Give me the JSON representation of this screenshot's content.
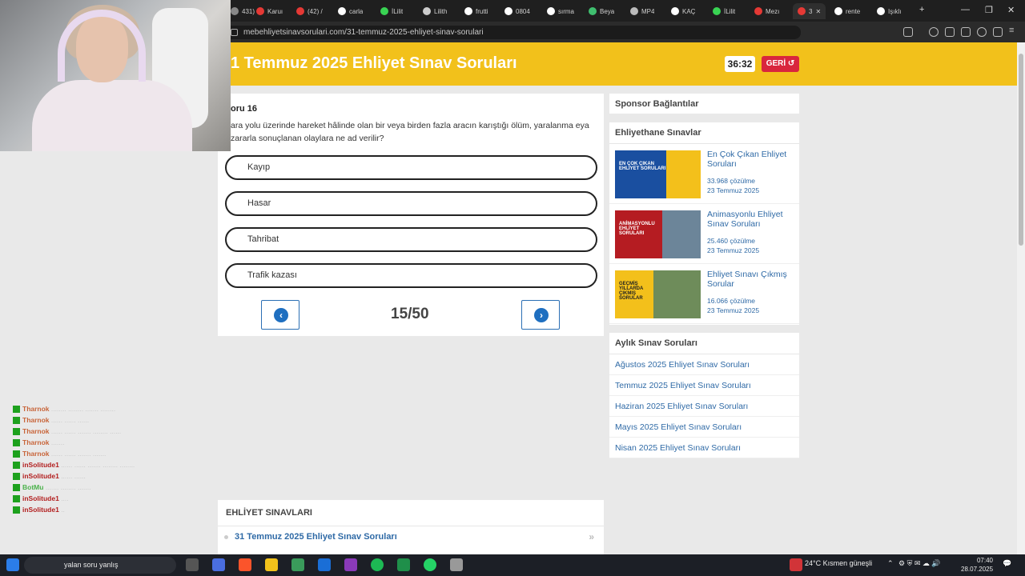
{
  "browser": {
    "tabs": [
      {
        "label": "431)",
        "color": "#888888"
      },
      {
        "label": "Karuı",
        "color": "#e53935"
      },
      {
        "label": "(42) /",
        "color": "#e53935"
      },
      {
        "label": "carla",
        "color": "#ffffff"
      },
      {
        "label": "İLilit",
        "color": "#39d353"
      },
      {
        "label": "Lilith",
        "color": "#cccccc"
      },
      {
        "label": "frutti",
        "color": "#ffffff"
      },
      {
        "label": "0804",
        "color": "#ffffff"
      },
      {
        "label": "sırma",
        "color": "#ffffff"
      },
      {
        "label": "Beya",
        "color": "#3fbf6f"
      },
      {
        "label": "MP4",
        "color": "#bbbbbb"
      },
      {
        "label": "KAÇ",
        "color": "#ffffff"
      },
      {
        "label": "İLilit",
        "color": "#39d353"
      },
      {
        "label": "Mezı",
        "color": "#e53935"
      },
      {
        "label": "3",
        "color": "#e53935"
      },
      {
        "label": "rente",
        "color": "#ffffff"
      },
      {
        "label": "Işıklı",
        "color": "#ffffff"
      }
    ],
    "url": "mebehliyetsinavsorulari.com/31-temmuz-2025-ehliyet-sinav-sorulari"
  },
  "header": {
    "title": "1 Temmuz 2025 Ehliyet Sınav Soruları",
    "timer": "36:32",
    "back_label": "GERİ"
  },
  "question": {
    "number_label": "oru 16",
    "text": "ara yolu üzerinde hareket hâlinde olan bir veya birden fazla aracın karıştığı ölüm, yaralanma eya zararla sonuçlanan olaylara ne ad verilir?",
    "options": [
      "Kayıp",
      "Hasar",
      "Tahribat",
      "Trafik kazası"
    ],
    "counter": "15/50"
  },
  "sidebar": {
    "sponsor_title": "Sponsor Bağlantılar",
    "ehliyethane_title": "Ehliyethane Sınavlar",
    "cards": [
      {
        "title": "En Çok Çıkan Ehliyet Soruları",
        "count": "33.968 çözülme",
        "date": "23 Temmuz 2025",
        "thumb_text": "EN ÇOK ÇIKAN EHLİYET SORULARI"
      },
      {
        "title": "Animasyonlu Ehliyet Sınav Soruları",
        "count": "25.460 çözülme",
        "date": "23 Temmuz 2025",
        "thumb_text": "ANİMASYONLU EHLİYET SORULARI"
      },
      {
        "title": "Ehliyet Sınavı Çıkmış Sorular",
        "count": "16.066 çözülme",
        "date": "23 Temmuz 2025",
        "thumb_text": "GEÇMİŞ YILLARDA ÇIKMIŞ SORULAR"
      }
    ],
    "monthly_title": "Aylık Sınav Soruları",
    "monthly": [
      "Ağustos 2025 Ehliyet Sınav Soruları",
      "Temmuz 2025 Ehliyet Sınav Soruları",
      "Haziran 2025 Ehliyet Sınav Soruları",
      "Mayıs 2025 Ehliyet Sınav Soruları",
      "Nisan 2025 Ehliyet Sınav Soruları"
    ]
  },
  "exams": {
    "title": "EHLİYET SINAVLARI",
    "first": "31 Temmuz 2025 Ehliyet Sınav Soruları"
  },
  "chat": [
    {
      "user": "Tharnok",
      "text": "........ ........ ....... ........",
      "style": "orange"
    },
    {
      "user": "Tharnok",
      "text": "...... ...... ......",
      "style": "orange"
    },
    {
      "user": "Tharnok",
      "text": "...... ...... ....... ........ ......",
      "style": "orange"
    },
    {
      "user": "Tharnok",
      "text": ".......",
      "style": "orange"
    },
    {
      "user": "Tharnok",
      "text": "...... ...... ....... .......",
      "style": "orange"
    },
    {
      "user": "inSolitude1",
      "text": "...... ...... ....... ........ ........",
      "style": "red"
    },
    {
      "user": "inSolitude1",
      "text": "...... ......",
      "style": "red"
    },
    {
      "user": "BotMu",
      "text": "....... ........ .......",
      "style": "green"
    },
    {
      "user": "inSolitude1",
      "text": "....",
      "style": "red"
    },
    {
      "user": "inSolitude1",
      "text": "..",
      "style": "red"
    }
  ],
  "taskbar": {
    "search_text": "yalan soru yanlış",
    "weather": "24°C  Kısmen güneşli",
    "time": "07:40",
    "date": "28.07.2025"
  }
}
